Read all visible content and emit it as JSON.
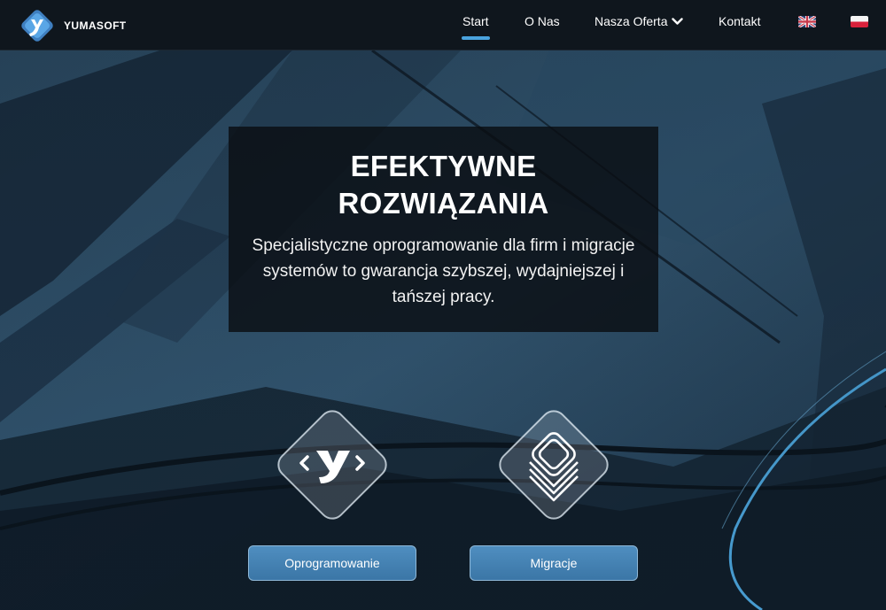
{
  "brand": {
    "name": "YUMASOFT",
    "logo_icon": "yumasoft-y-logo"
  },
  "nav": {
    "items": [
      {
        "label": "Start",
        "active": true
      },
      {
        "label": "O Nas",
        "active": false
      },
      {
        "label": "Nasza Oferta",
        "active": false,
        "icon": "chevron-down-icon"
      },
      {
        "label": "Kontakt",
        "active": false
      }
    ],
    "languages": [
      {
        "code": "en",
        "icon": "uk-flag-icon"
      },
      {
        "code": "pl",
        "icon": "pl-flag-icon"
      }
    ]
  },
  "hero": {
    "title": "EFEKTYWNE\nROZWIĄZANIA",
    "subtitle": "Specjalistyczne oprogramowanie dla firm i migracje systemów to gwarancja szybszej, wydajniejszej i tańszej pracy."
  },
  "services": [
    {
      "label": "Oprogramowanie",
      "icon": "code-brackets-y-icon"
    },
    {
      "label": "Migracje",
      "icon": "stacked-layers-icon"
    }
  ],
  "colors": {
    "accent": "#4aa3de",
    "nav_bg": "#0f161d",
    "button": "#4681b3",
    "overlay": "#0a0e12"
  }
}
